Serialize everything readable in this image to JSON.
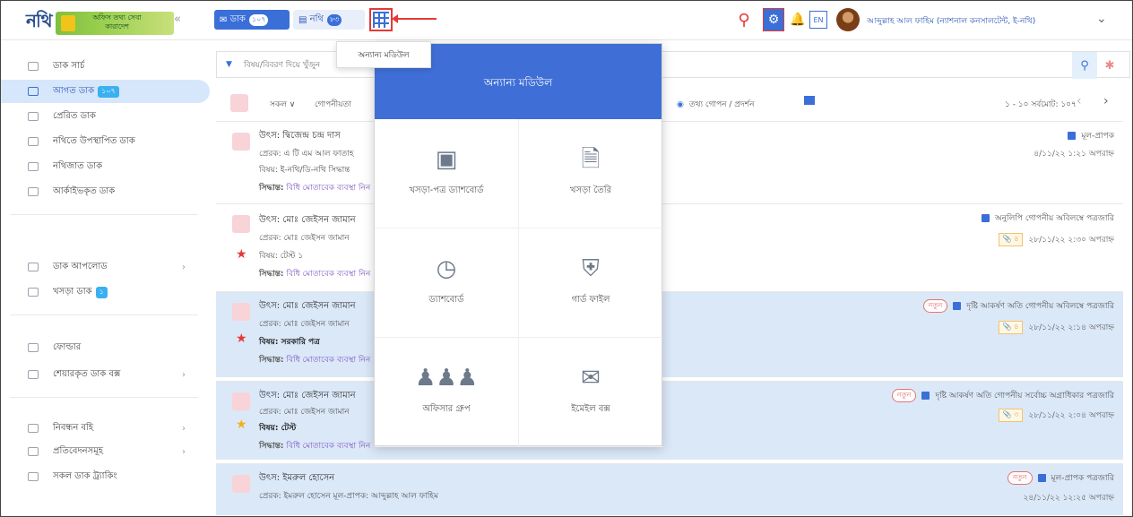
{
  "header": {
    "logo_word": "নথি",
    "logo_badge": "অফিস তথ্য সেবা কারাদেশ",
    "collapse_icon": "chevron-double-left",
    "dak_label": "ডাক",
    "dak_count": "১০৭",
    "nothi_label": "নথি",
    "nothi_count": "৮৩",
    "grid_tooltip": "অন্যান্য মডিউল",
    "lang_label": "EN",
    "user_name": "আব্দুল্লাহ আল ফাহিম (ন্যাশনাল কনসালটেন্ট, ই-নথি)"
  },
  "sidebar": {
    "items": [
      {
        "label": "ডাক সার্চ"
      },
      {
        "label": "আগত ডাক",
        "badge": "১০৭"
      },
      {
        "label": "প্রেরিত ডাক"
      },
      {
        "label": "নথিতে উপস্থাপিত ডাক"
      },
      {
        "label": "নথিজাত ডাক"
      },
      {
        "label": "আর্কাইভকৃত ডাক"
      },
      {
        "label": "ডাক আপলোড"
      },
      {
        "label": "খসড়া ডাক",
        "badge": "১"
      },
      {
        "label": "ফোল্ডার"
      },
      {
        "label": "শেয়ারকৃত ডাক বক্স"
      },
      {
        "label": "নিবন্ধন বহি"
      },
      {
        "label": "প্রতিবেদনসমূহ"
      },
      {
        "label": "সকল ডাক ট্র্যাকিং"
      }
    ]
  },
  "filter": {
    "placeholder": "বিষয়/বিবরণ দিয়ে খুঁজুন"
  },
  "toolbar": {
    "all_label": "সকল ∨",
    "secret_label": "গোপনীয়তা",
    "info_label": "তথ্য গোপন / প্রদর্শন",
    "pagination": "১ - ১০ সর্বমোট: ১০৭"
  },
  "rows": [
    {
      "source": "উৎস: দ্বিজেন্দ্র চন্দ্র দাস",
      "sender": "প্রেরক: এ টি এম আল ফাতাহ",
      "subject": "বিষয়: ই-নথি/ডি-নথি সিদ্ধান্ত",
      "decision_prefix": "সিদ্ধান্ত:",
      "decision": "বিধি মোতাবেক ব্যবস্থা নিন",
      "tags": "মূল-প্রাপক",
      "date": "৪/১১/২২ ১:২১ অপরাহ্ন"
    },
    {
      "source": "উৎস: মোঃ জেইসন জামান",
      "sender": "প্রেরক: মোঃ জেইসন জামান",
      "subject": "বিষয়: টেস্ট ১",
      "decision_prefix": "সিদ্ধান্ত:",
      "decision": "বিধি মোতাবেক ব্যবস্থা নিন",
      "tags": "অনুলিপি   গোপনীয়   অবিলম্বে   পত্রজারি",
      "attach": "৪",
      "date": "২৮/১১/২২ ২:৩০ অপরাহ্ন"
    },
    {
      "source": "উৎস: মোঃ জেইসন জামান",
      "sender": "প্রেরক: মোঃ জেইসন জামান",
      "subject": "বিষয়: সরকারি পত্র",
      "decision_prefix": "সিদ্ধান্ত:",
      "decision": "বিধি মোতাবেক ব্যবস্থা নিন",
      "new_label": "নতুন",
      "tags": "দৃষ্টি আকর্ষণ   অতি গোপনীয়   অবিলম্বে   পত্রজারি",
      "attach": "৪",
      "date": "২৮/১১/২২ ২:১৪ অপরাহ্ন"
    },
    {
      "source": "উৎস: মোঃ জেইসন জামান",
      "sender": "প্রেরক: মোঃ জেইসন জামান",
      "subject": "বিষয়: টেস্ট",
      "decision_prefix": "সিদ্ধান্ত:",
      "decision": "বিধি মোতাবেক ব্যবস্থা নিন",
      "new_label": "নতুন",
      "tags": "দৃষ্টি আকর্ষণ   অতি গোপনীয়   সর্বোচ্চ অগ্রাধিকার   পত্রজারি",
      "attach": "৩",
      "date": "২৮/১১/২২ ২:০৪ অপরাহ্ন"
    },
    {
      "source": "উৎস: ইমরুল হোসেন",
      "sender": "প্রেরক: ইমরুল হোসেন  মূল-প্রাপক: আব্দুল্লাহ আল ফাহিম",
      "new_label": "নতুন",
      "tags": "মূল-প্রাপক   পত্রজারি",
      "date": "২৪/১১/২২ ১২:২৫ অপরাহ্ন"
    }
  ],
  "modal": {
    "title": "অন্যান্য মডিউল",
    "tiles": [
      {
        "label": "খসড়া-পত্র ড্যাশবোর্ড",
        "icon": "laptop-icon"
      },
      {
        "label": "খসড়া তৈরি",
        "icon": "document-icon"
      },
      {
        "label": "ড্যাশবোর্ড",
        "icon": "gauge-icon"
      },
      {
        "label": "গার্ড ফাইল",
        "icon": "shield-icon"
      },
      {
        "label": "অফিসার গ্রুপ",
        "icon": "users-icon"
      },
      {
        "label": "ইমেইল বক্স",
        "icon": "envelope-icon"
      }
    ]
  },
  "colors": {
    "primary": "#3a6fd8",
    "highlight_row": "#dbe8f8",
    "accent_red": "#e53935"
  }
}
